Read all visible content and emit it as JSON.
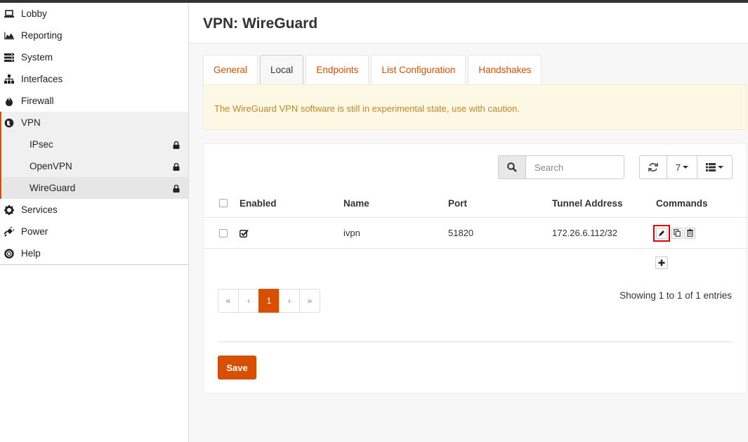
{
  "sidebar": {
    "items": [
      {
        "label": "Lobby",
        "icon": "laptop-icon"
      },
      {
        "label": "Reporting",
        "icon": "area-chart-icon"
      },
      {
        "label": "System",
        "icon": "server-icon"
      },
      {
        "label": "Interfaces",
        "icon": "sitemap-icon"
      },
      {
        "label": "Firewall",
        "icon": "fire-icon"
      },
      {
        "label": "VPN",
        "icon": "globe-icon"
      },
      {
        "label": "Services",
        "icon": "gear-icon"
      },
      {
        "label": "Power",
        "icon": "plug-icon"
      },
      {
        "label": "Help",
        "icon": "life-ring-icon"
      }
    ],
    "vpn_sub": [
      {
        "label": "IPsec"
      },
      {
        "label": "OpenVPN"
      },
      {
        "label": "WireGuard"
      }
    ]
  },
  "page": {
    "title": "VPN: WireGuard"
  },
  "tabs": [
    {
      "label": "General"
    },
    {
      "label": "Local"
    },
    {
      "label": "Endpoints"
    },
    {
      "label": "List Configuration"
    },
    {
      "label": "Handshakes"
    }
  ],
  "alert": {
    "text": "The WireGuard VPN software is still in experimental state, use with caution."
  },
  "toolbar": {
    "search_placeholder": "Search",
    "page_size": "7"
  },
  "grid": {
    "headers": {
      "enabled": "Enabled",
      "name": "Name",
      "port": "Port",
      "tunnel": "Tunnel Address",
      "commands": "Commands"
    },
    "rows": [
      {
        "enabled": true,
        "name": "ivpn",
        "port": "51820",
        "tunnel": "172.26.6.112/32"
      }
    ]
  },
  "pager": {
    "first": "«",
    "prev": "‹",
    "current": "1",
    "next": "›",
    "last": "»"
  },
  "footer": {
    "showing": "Showing 1 to 1 of 1 entries",
    "save_label": "Save"
  },
  "colors": {
    "accent": "#d94f00",
    "alert_bg": "#fcf8e3",
    "alert_text": "#c3862a"
  }
}
